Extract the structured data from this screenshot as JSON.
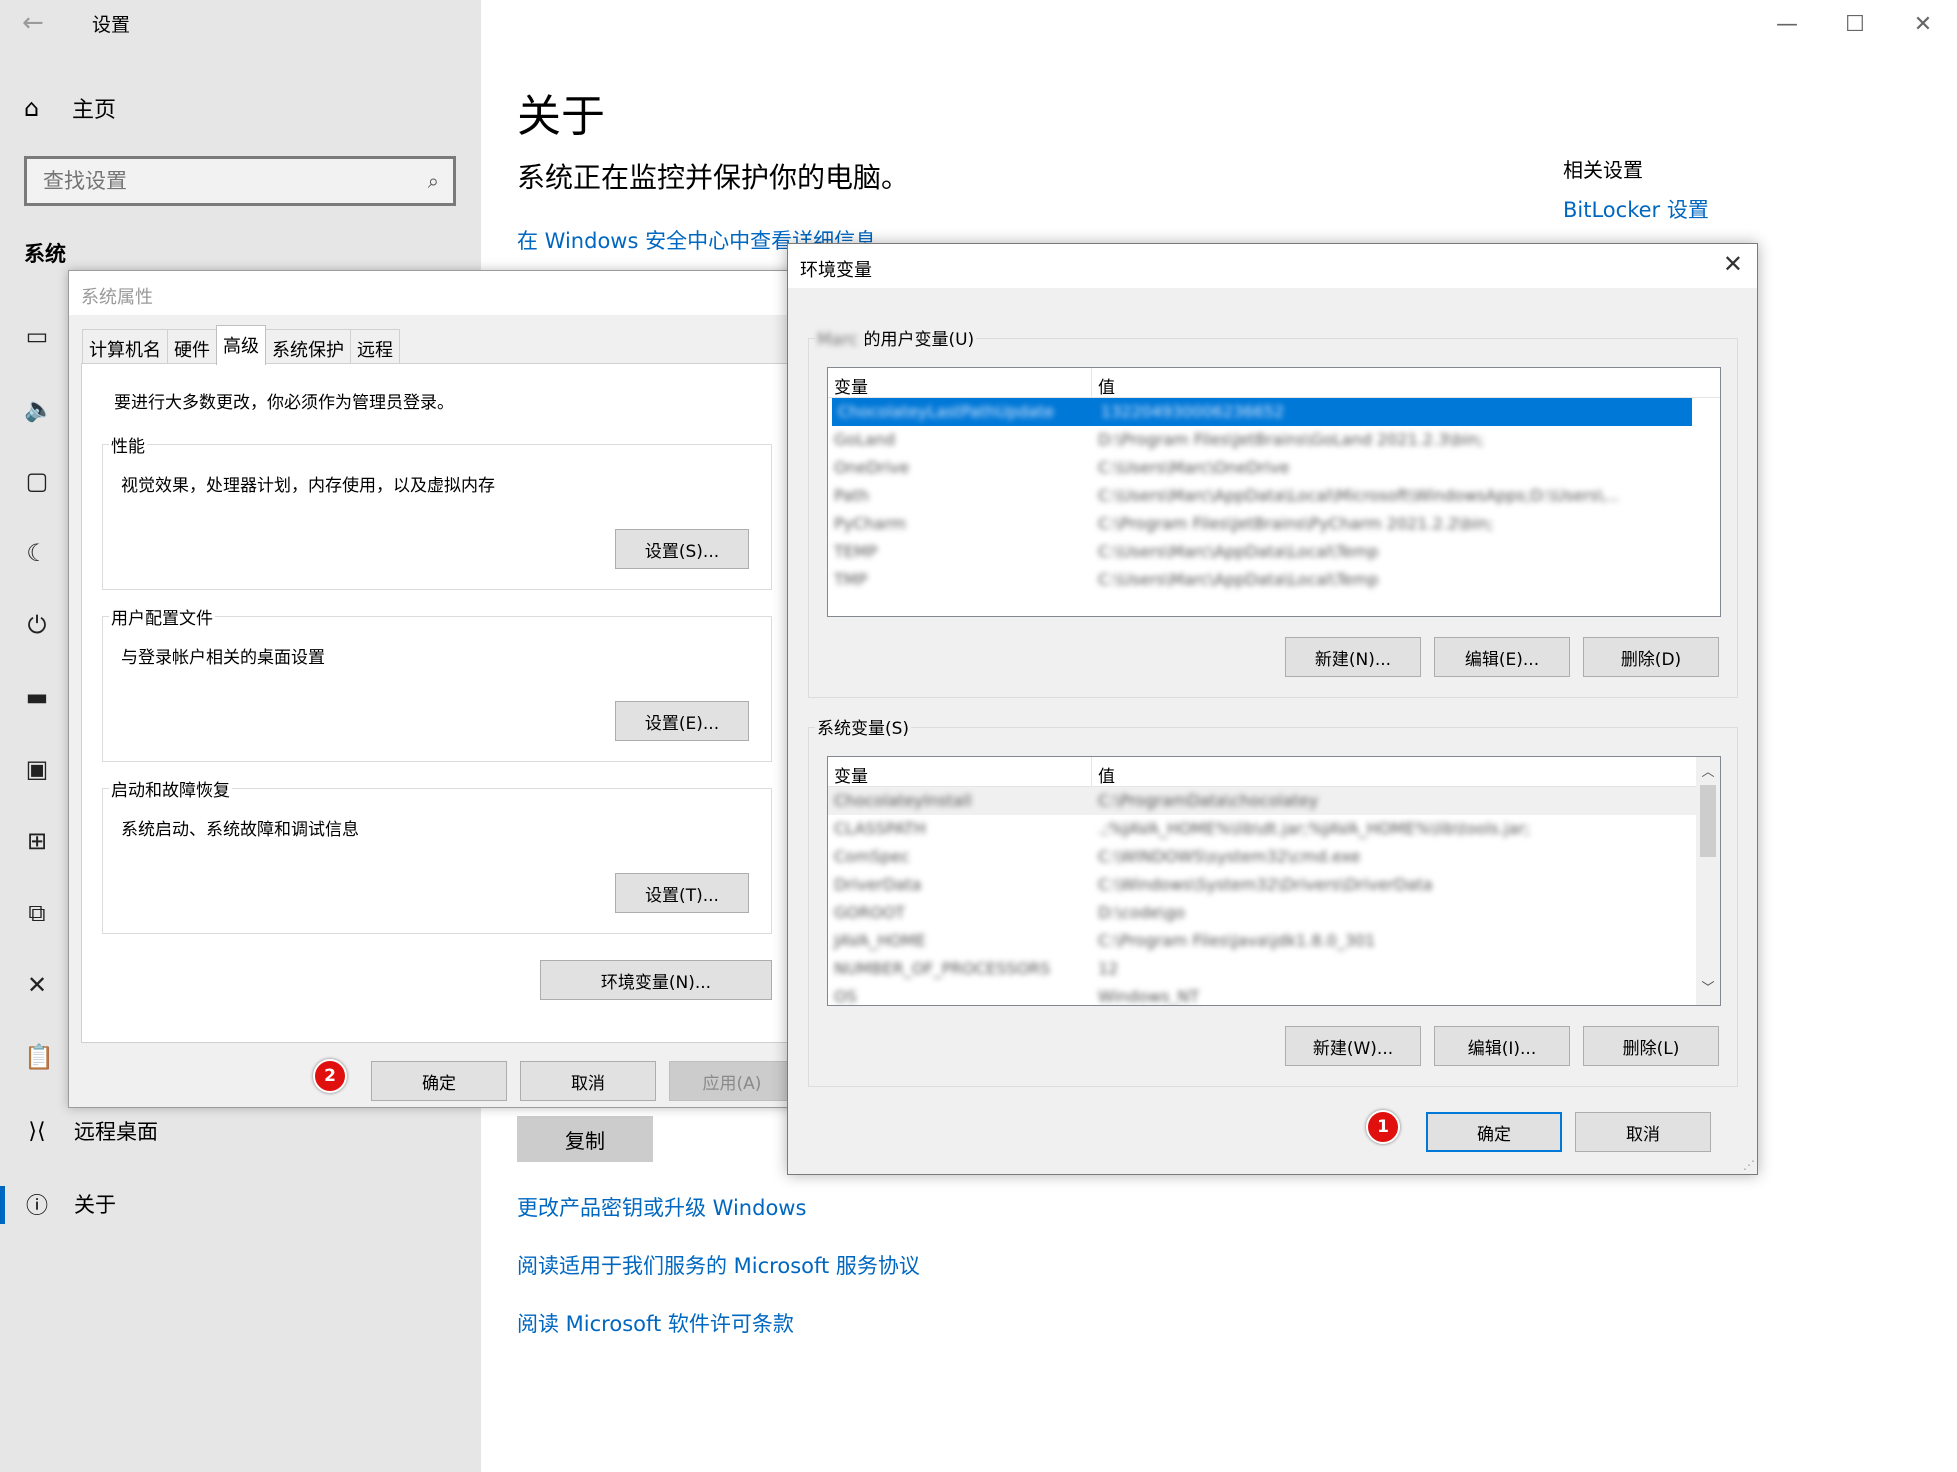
{
  "settings": {
    "app_title": "设置",
    "home_label": "主页",
    "search_placeholder": "查找设置",
    "section_title": "系统",
    "nav_remote_desktop": "远程桌面",
    "nav_about": "关于",
    "window_controls": [
      "—",
      "☐",
      "✕"
    ]
  },
  "about": {
    "title": "关于",
    "subtitle": "系统正在监控并保护你的电脑。",
    "security_link": "在 Windows 安全中心中查看详细信息",
    "related_heading": "相关设置",
    "bitlocker_link": "BitLocker 设置",
    "copy_button": "复制",
    "links": [
      "更改产品密钥或升级 Windows",
      "阅读适用于我们服务的 Microsoft 服务协议",
      "阅读 Microsoft 软件许可条款"
    ]
  },
  "sysprop": {
    "title": "系统属性",
    "tabs": [
      "计算机名",
      "硬件",
      "高级",
      "系统保护",
      "远程"
    ],
    "active_tab": "高级",
    "admin_note": "要进行大多数更改，你必须作为管理员登录。",
    "performance": {
      "legend": "性能",
      "desc": "视觉效果，处理器计划，内存使用，以及虚拟内存",
      "button": "设置(S)..."
    },
    "profiles": {
      "legend": "用户配置文件",
      "desc": "与登录帐户相关的桌面设置",
      "button": "设置(E)..."
    },
    "startup": {
      "legend": "启动和故障恢复",
      "desc": "系统启动、系统故障和调试信息",
      "button": "设置(T)..."
    },
    "env_button": "环境变量(N)...",
    "ok": "确定",
    "cancel": "取消",
    "apply": "应用(A)",
    "badge": "2"
  },
  "envdlg": {
    "title": "环境变量",
    "user_name_blurred": "Marc",
    "user_vars_legend": "的用户变量(U)",
    "col_var": "变量",
    "col_val": "值",
    "user_vars": [
      {
        "name": "ChocolateyLastPathUpdate",
        "value": "132204930006236652"
      },
      {
        "name": "GoLand",
        "value": "D:\\Program Files\\JetBrains\\GoLand 2021.2.3\\bin;"
      },
      {
        "name": "OneDrive",
        "value": "C:\\Users\\Marc\\OneDrive"
      },
      {
        "name": "Path",
        "value": "C:\\Users\\Marc\\AppData\\Local\\Microsoft\\WindowsApps;D:\\Users\\..."
      },
      {
        "name": "PyCharm",
        "value": "C:\\Program Files\\JetBrains\\PyCharm 2021.2.2\\bin;"
      },
      {
        "name": "TEMP",
        "value": "C:\\Users\\Marc\\AppData\\Local\\Temp"
      },
      {
        "name": "TMP",
        "value": "C:\\Users\\Marc\\AppData\\Local\\Temp"
      }
    ],
    "user_new": "新建(N)...",
    "user_edit": "编辑(E)...",
    "user_delete": "删除(D)",
    "sys_vars_legend": "系统变量(S)",
    "sys_vars": [
      {
        "name": "ChocolateyInstall",
        "value": "C:\\ProgramData\\chocolatey"
      },
      {
        "name": "CLASSPATH",
        "value": ".;%JAVA_HOME%\\lib\\dt.jar;%JAVA_HOME%\\lib\\tools.jar;"
      },
      {
        "name": "ComSpec",
        "value": "C:\\WINDOWS\\system32\\cmd.exe"
      },
      {
        "name": "DriverData",
        "value": "C:\\Windows\\System32\\Drivers\\DriverData"
      },
      {
        "name": "GOROOT",
        "value": "D:\\code\\go"
      },
      {
        "name": "JAVA_HOME",
        "value": "C:\\Program Files\\Java\\jdk1.8.0_301"
      },
      {
        "name": "NUMBER_OF_PROCESSORS",
        "value": "12"
      },
      {
        "name": "OS",
        "value": "Windows_NT"
      }
    ],
    "sys_new": "新建(W)...",
    "sys_edit": "编辑(I)...",
    "sys_delete": "删除(L)",
    "ok": "确定",
    "cancel": "取消",
    "badge": "1"
  }
}
